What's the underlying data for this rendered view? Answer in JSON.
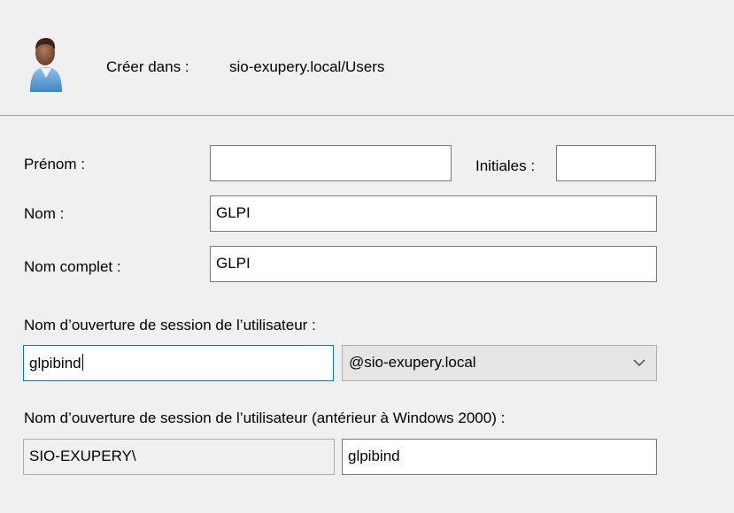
{
  "header": {
    "create_in_label": "Créer dans :",
    "create_in_value": "sio-exupery.local/Users"
  },
  "form": {
    "first_name": {
      "label": "Prénom :",
      "value": ""
    },
    "initials": {
      "label": "Initiales :",
      "value": ""
    },
    "last_name": {
      "label": "Nom :",
      "value": "GLPI"
    },
    "full_name": {
      "label": "Nom complet :",
      "value": "GLPI"
    },
    "logon_name": {
      "label": "Nom d’ouverture de session de l’utilisateur :",
      "value": "glpibind",
      "domain_selected": "@sio-exupery.local"
    },
    "logon_name_pre2000": {
      "label": "Nom d’ouverture de session de l’utilisateur (antérieur à Windows 2000) :",
      "domain_prefix": "SIO-EXUPERY\\",
      "value": "glpibind"
    }
  }
}
